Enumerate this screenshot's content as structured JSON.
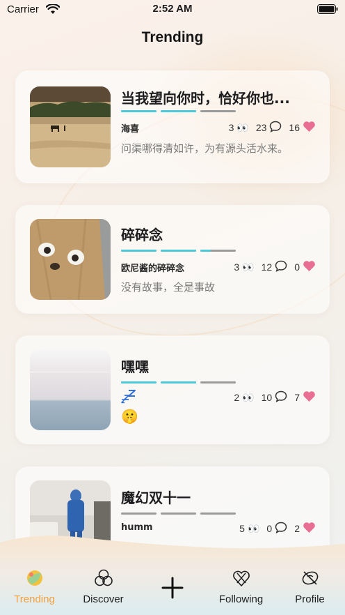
{
  "status_bar": {
    "carrier": "Carrier",
    "time": "2:52 AM"
  },
  "header": {
    "title": "Trending"
  },
  "cards": [
    {
      "title": "当我望向你时，恰好你也...",
      "author": "海喜",
      "views": "3",
      "comments": "23",
      "likes": "16",
      "excerpt": "问渠哪得清如许，为有源头活水来。",
      "progress": [
        1,
        1,
        0
      ]
    },
    {
      "title": "碎碎念",
      "author": "欧尼酱的碎碎念",
      "views": "3",
      "comments": "12",
      "likes": "0",
      "excerpt": "没有故事，全是事故",
      "progress": [
        1,
        1,
        0.3
      ]
    },
    {
      "title": "嘿嘿",
      "author": "",
      "views": "2",
      "comments": "10",
      "likes": "7",
      "excerpt": "🤫",
      "progress": [
        1,
        1,
        0
      ]
    },
    {
      "title": "魔幻双十一",
      "author": "humm",
      "views": "5",
      "comments": "0",
      "likes": "2",
      "excerpt": "",
      "progress": [
        0,
        0,
        0
      ]
    }
  ],
  "tabbar": {
    "tabs": [
      {
        "label": "Trending",
        "icon": "trending-icon",
        "active": true
      },
      {
        "label": "Discover",
        "icon": "discover-icon",
        "active": false
      },
      {
        "label": "",
        "icon": "plus-icon",
        "active": false
      },
      {
        "label": "Following",
        "icon": "following-icon",
        "active": false
      },
      {
        "label": "Profile",
        "icon": "profile-icon",
        "active": false
      }
    ]
  },
  "colors": {
    "accent": "#4cc9d8",
    "like": "#e86f93",
    "active_tab": "#f0a040"
  }
}
